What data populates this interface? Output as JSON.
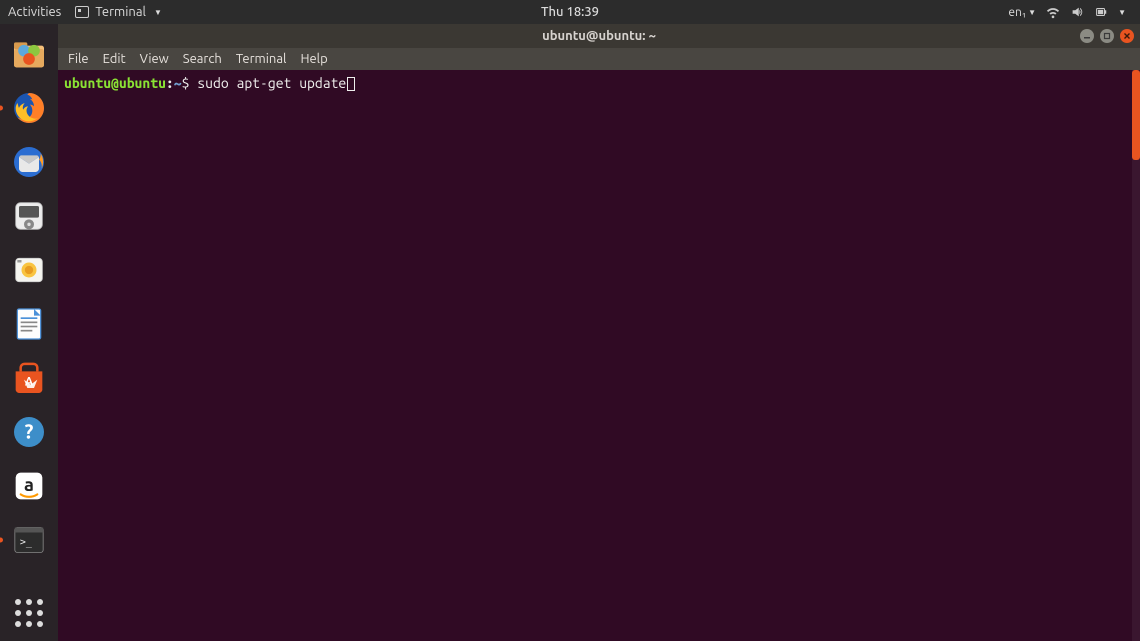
{
  "top_panel": {
    "activities": "Activities",
    "appmenu_label": "Terminal",
    "clock": "Thu 18:39",
    "lang": "en₁"
  },
  "launcher": {
    "items": [
      {
        "name": "nautilus-files",
        "label": "Files"
      },
      {
        "name": "firefox",
        "label": "Firefox"
      },
      {
        "name": "thunderbird",
        "label": "Thunderbird"
      },
      {
        "name": "rhythmbox",
        "label": "Rhythmbox"
      },
      {
        "name": "shotwell",
        "label": "Shotwell"
      },
      {
        "name": "libreoffice-writer",
        "label": "LibreOffice Writer"
      },
      {
        "name": "ubuntu-software",
        "label": "Ubuntu Software"
      },
      {
        "name": "help",
        "label": "Help"
      },
      {
        "name": "amazon",
        "label": "Amazon"
      },
      {
        "name": "terminal",
        "label": "Terminal"
      }
    ]
  },
  "window": {
    "title": "ubuntu@ubuntu: ~",
    "menus": [
      "File",
      "Edit",
      "View",
      "Search",
      "Terminal",
      "Help"
    ]
  },
  "terminal": {
    "prompt_user_host": "ubuntu@ubuntu",
    "prompt_colon": ":",
    "prompt_path": "~",
    "prompt_symbol": "$",
    "command": " sudo apt-get update"
  }
}
